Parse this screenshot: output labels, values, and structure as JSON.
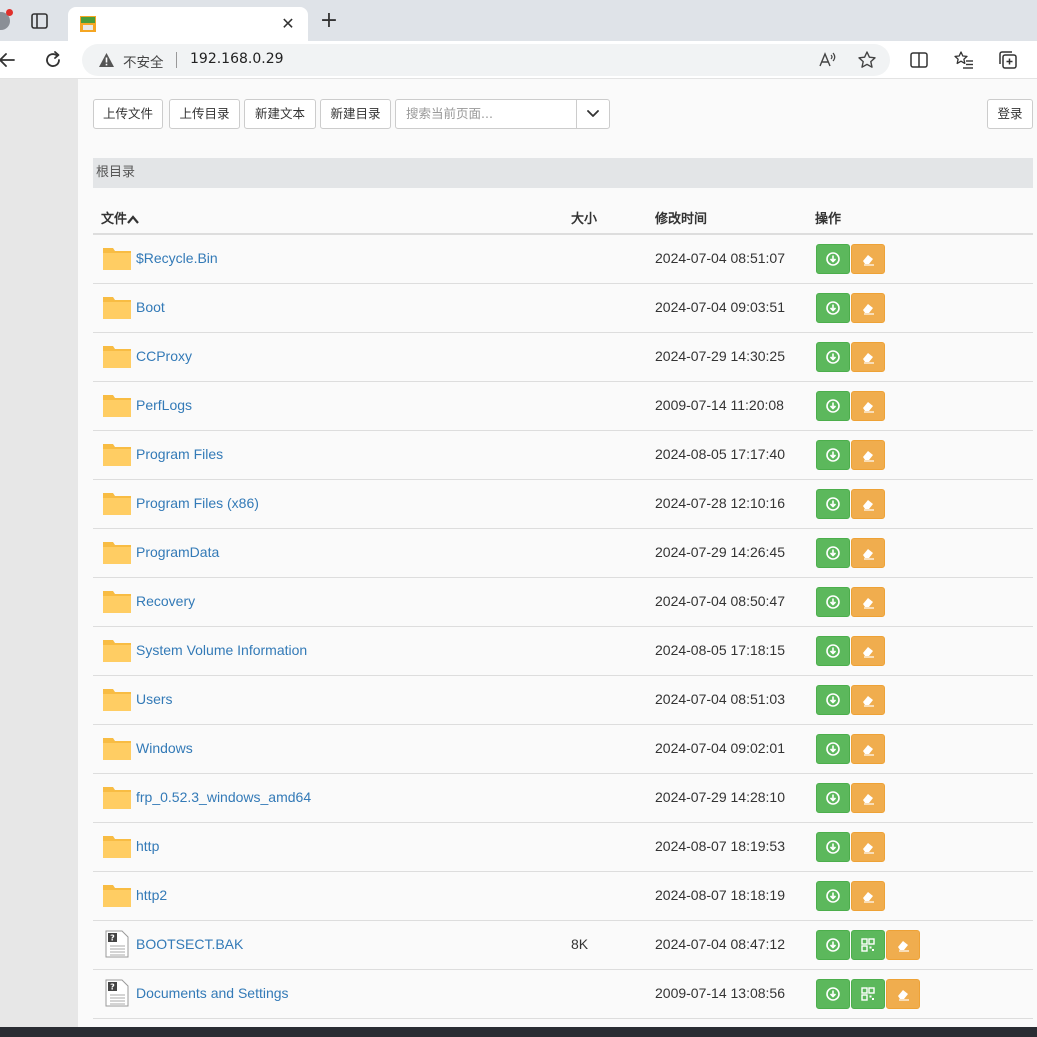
{
  "browser": {
    "tab_close_glyph": "✕",
    "new_tab_glyph": "+",
    "security_label": "不安全",
    "url": "192.168.0.29",
    "colors": {
      "tabbar": "#dfe3e8",
      "warning": "#444444"
    }
  },
  "toolbar": {
    "upload_file": "上传文件",
    "upload_dir": "上传目录",
    "new_text": "新建文本",
    "new_dir": "新建目录",
    "search_placeholder": "搜索当前页面...",
    "login": "登录"
  },
  "breadcrumb": "根目录",
  "table": {
    "headers": {
      "name": "文件",
      "size": "大小",
      "mtime": "修改时间",
      "actions": "操作"
    },
    "rows": [
      {
        "name": "$Recycle.Bin",
        "type": "folder",
        "size": "",
        "mtime": "2024-07-04 08:51:07"
      },
      {
        "name": "Boot",
        "type": "folder",
        "size": "",
        "mtime": "2024-07-04 09:03:51"
      },
      {
        "name": "CCProxy",
        "type": "folder",
        "size": "",
        "mtime": "2024-07-29 14:30:25"
      },
      {
        "name": "PerfLogs",
        "type": "folder",
        "size": "",
        "mtime": "2009-07-14 11:20:08"
      },
      {
        "name": "Program Files",
        "type": "folder",
        "size": "",
        "mtime": "2024-08-05 17:17:40"
      },
      {
        "name": "Program Files (x86)",
        "type": "folder",
        "size": "",
        "mtime": "2024-07-28 12:10:16"
      },
      {
        "name": "ProgramData",
        "type": "folder",
        "size": "",
        "mtime": "2024-07-29 14:26:45"
      },
      {
        "name": "Recovery",
        "type": "folder",
        "size": "",
        "mtime": "2024-07-04 08:50:47"
      },
      {
        "name": "System Volume Information",
        "type": "folder",
        "size": "",
        "mtime": "2024-08-05 17:18:15"
      },
      {
        "name": "Users",
        "type": "folder",
        "size": "",
        "mtime": "2024-07-04 08:51:03"
      },
      {
        "name": "Windows",
        "type": "folder",
        "size": "",
        "mtime": "2024-07-04 09:02:01"
      },
      {
        "name": "frp_0.52.3_windows_amd64",
        "type": "folder",
        "size": "",
        "mtime": "2024-07-29 14:28:10"
      },
      {
        "name": "http",
        "type": "folder",
        "size": "",
        "mtime": "2024-08-07 18:19:53"
      },
      {
        "name": "http2",
        "type": "folder",
        "size": "",
        "mtime": "2024-08-07 18:18:19"
      },
      {
        "name": "BOOTSECT.BAK",
        "type": "file",
        "size": "8K",
        "mtime": "2024-07-04 08:47:12"
      },
      {
        "name": "Documents and Settings",
        "type": "file",
        "size": "",
        "mtime": "2009-07-14 13:08:56"
      }
    ]
  },
  "colors": {
    "link": "#337ab7",
    "download_button": "#5cb85c",
    "edit_button": "#f0ad4e",
    "folder": "#ffca5f"
  },
  "icons": {
    "download": "download-icon",
    "qrcode": "qrcode-icon",
    "erase": "eraser-icon",
    "folder": "folder-icon",
    "file": "unknown-file-icon"
  }
}
